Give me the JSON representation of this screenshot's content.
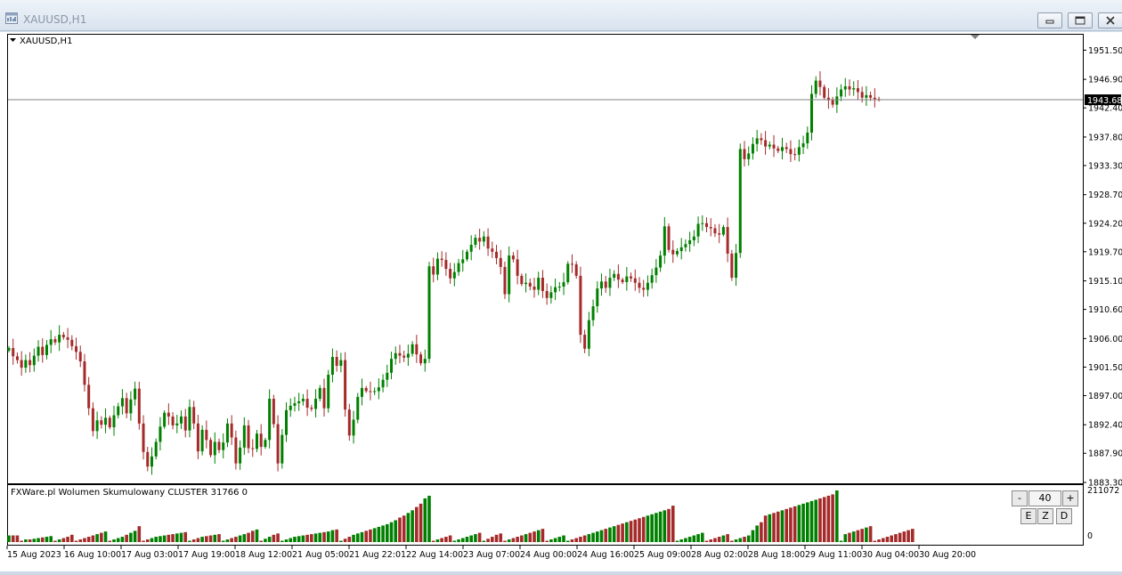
{
  "window": {
    "title": "XAUUSD,H1",
    "icon": "chart-window-icon"
  },
  "chart_data": {
    "type": "candlestick",
    "symbol_label": "XAUUSD,H1",
    "ylim": [
      1883.3,
      1953.8
    ],
    "price_ticks": [
      "1951.50",
      "1946.90",
      "1942.40",
      "1937.80",
      "1933.30",
      "1928.70",
      "1924.20",
      "1919.70",
      "1915.10",
      "1910.60",
      "1906.00",
      "1901.50",
      "1897.00",
      "1892.40",
      "1887.90",
      "1883.30"
    ],
    "current_price": "1943.68",
    "current_price_value": 1943.68,
    "time_labels": [
      "15 Aug 2023",
      "16 Aug 10:00",
      "17 Aug 03:00",
      "17 Aug 19:00",
      "18 Aug 12:00",
      "21 Aug 05:00",
      "21 Aug 22:01",
      "22 Aug 14:00",
      "23 Aug 07:00",
      "24 Aug 00:00",
      "24 Aug 16:00",
      "25 Aug 09:00",
      "28 Aug 02:00",
      "28 Aug 18:00",
      "29 Aug 11:00",
      "30 Aug 04:00",
      "30 Aug 20:00"
    ],
    "series": [
      {
        "values": [
          1904.5,
          1903.2,
          1902.6,
          1901.4,
          1902.6,
          1901.8,
          1903.3,
          1904.7,
          1903.4,
          1905.0,
          1905.9,
          1905.4,
          1906.6,
          1906.2,
          1905.8,
          1904.8,
          1903.9,
          1902.4,
          1898.7,
          1895.0,
          1891.4,
          1893.1,
          1892.4,
          1893.5,
          1892.0,
          1893.9,
          1895.3,
          1896.6,
          1894.2,
          1896.4,
          1898.1,
          1892.6,
          1888.1,
          1885.8,
          1887.4,
          1889.7,
          1892.1,
          1894.3,
          1893.7,
          1892.3,
          1892.6,
          1893.7,
          1891.5,
          1895.2,
          1892.6,
          1888.2,
          1891.6,
          1890.0,
          1887.6,
          1889.7,
          1888.4,
          1889.6,
          1892.6,
          1890.4,
          1886.3,
          1888.8,
          1892.3,
          1888.7,
          1888.6,
          1891.0,
          1888.9,
          1890.0,
          1896.5,
          1892.5,
          1886.3,
          1890.8,
          1894.7,
          1895.4,
          1895.8,
          1896.1,
          1896.5,
          1895.1,
          1894.9,
          1896.5,
          1898.2,
          1895.0,
          1900.3,
          1903.1,
          1901.7,
          1902.6,
          1894.8,
          1890.7,
          1893.2,
          1896.8,
          1898.2,
          1897.7,
          1897.6,
          1897.7,
          1898.3,
          1899.5,
          1900.6,
          1902.8,
          1903.7,
          1903.3,
          1903.0,
          1903.6,
          1905.1,
          1903.5,
          1902.1,
          1902.8,
          1917.4,
          1916.1,
          1918.6,
          1918.4,
          1917.0,
          1915.5,
          1916.5,
          1917.9,
          1918.5,
          1919.7,
          1920.8,
          1921.9,
          1921.3,
          1922.1,
          1920.2,
          1919.7,
          1918.7,
          1917.3,
          1913.0,
          1919.1,
          1918.5,
          1915.9,
          1914.6,
          1914.8,
          1914.2,
          1913.7,
          1915.6,
          1913.5,
          1912.4,
          1913.3,
          1914.1,
          1914.2,
          1914.9,
          1917.8,
          1917.7,
          1915.9,
          1906.6,
          1904.4,
          1908.9,
          1911.1,
          1913.9,
          1915.0,
          1914.0,
          1915.6,
          1916.2,
          1915.3,
          1914.9,
          1915.8,
          1915.5,
          1914.8,
          1914.0,
          1913.7,
          1914.8,
          1916.0,
          1917.2,
          1919.1,
          1923.7,
          1920.0,
          1919.3,
          1919.8,
          1920.4,
          1920.9,
          1921.5,
          1922.1,
          1924.1,
          1924.2,
          1923.6,
          1923.4,
          1922.6,
          1922.4,
          1923.6,
          1919.4,
          1915.6,
          1919.5,
          1935.9,
          1934.3,
          1935.2,
          1936.7,
          1937.6,
          1937.3,
          1936.3,
          1936.6,
          1936.0,
          1935.6,
          1936.2,
          1935.9,
          1935.1,
          1935.0,
          1936.2,
          1936.8,
          1938.5,
          1944.6,
          1946.7,
          1945.7,
          1944.0,
          1943.6,
          1942.9,
          1944.2,
          1945.3,
          1945.8,
          1945.3,
          1945.5,
          1944.9,
          1944.0,
          1944.4,
          1944.0,
          1943.8,
          1943.7
        ],
        "volume": [
          10,
          10,
          10,
          2,
          4,
          4,
          5,
          6,
          7,
          8,
          9,
          2,
          4,
          6,
          8,
          11,
          2,
          4,
          6,
          8,
          10,
          12,
          14,
          16,
          2,
          4,
          6,
          8,
          11,
          14,
          17,
          24,
          2,
          4,
          6,
          8,
          9,
          10,
          11,
          12,
          13,
          14,
          15,
          2,
          4,
          6,
          8,
          9,
          10,
          11,
          12,
          2,
          4,
          6,
          8,
          10,
          12,
          14,
          17,
          19,
          2,
          5,
          8,
          11,
          13,
          2,
          4,
          6,
          8,
          9,
          10,
          11,
          12,
          13,
          14,
          15,
          16,
          18,
          19,
          2,
          5,
          8,
          11,
          13,
          15,
          17,
          19,
          21,
          23,
          25,
          27,
          30,
          33,
          37,
          40,
          44,
          48,
          53,
          58,
          66,
          70,
          2,
          4,
          6,
          8,
          10,
          2,
          4,
          6,
          8,
          10,
          12,
          14,
          2,
          5,
          8,
          11,
          13,
          2,
          4,
          6,
          8,
          10,
          12,
          14,
          16,
          18,
          20,
          2,
          4,
          6,
          8,
          10,
          2,
          4,
          6,
          8,
          10,
          12,
          14,
          16,
          18,
          20,
          22,
          24,
          26,
          28,
          30,
          32,
          34,
          36,
          38,
          40,
          42,
          44,
          46,
          48,
          50,
          55,
          2,
          4,
          6,
          8,
          10,
          12,
          14,
          2,
          4,
          6,
          8,
          10,
          12,
          2,
          4,
          6,
          8,
          10,
          18,
          25,
          30,
          40,
          42,
          44,
          46,
          48,
          50,
          52,
          54,
          56,
          58,
          60,
          62,
          64,
          66,
          68,
          70,
          72,
          78,
          2,
          12,
          14,
          16,
          18,
          20,
          22,
          24,
          2,
          4,
          6,
          8,
          10,
          12,
          14,
          16,
          18,
          20
        ]
      }
    ]
  },
  "indicator": {
    "title": "FXWare.pl Wolumen Skumulowany CLUSTER 31766 0",
    "scale_max": "211072",
    "scale_min": "0",
    "controls": {
      "minus": "-",
      "period": "40",
      "plus": "+",
      "e": "E",
      "z": "Z",
      "d": "D"
    }
  },
  "colors": {
    "bull": "#008000",
    "bear": "#a52a2a",
    "grid": "#000000",
    "price_line": "#808080",
    "price_label_bg": "#000000",
    "background": "#ffffff"
  }
}
